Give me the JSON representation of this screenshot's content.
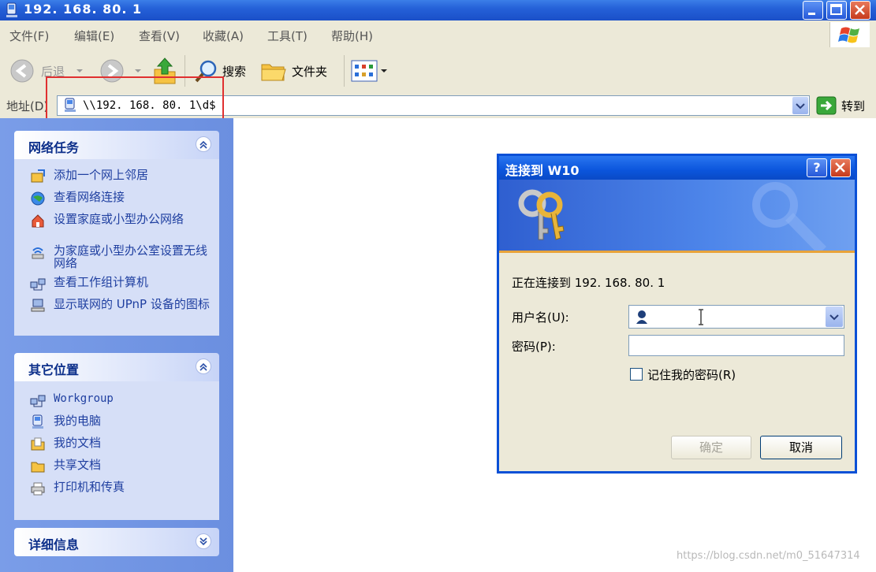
{
  "window": {
    "title": "192. 168. 80. 1"
  },
  "menu": {
    "items": [
      "文件(F)",
      "编辑(E)",
      "查看(V)",
      "收藏(A)",
      "工具(T)",
      "帮助(H)"
    ]
  },
  "toolbar": {
    "back_label": "后退",
    "search_label": "搜索",
    "folders_label": "文件夹"
  },
  "address": {
    "label": "地址(D)",
    "value": "\\\\192. 168. 80. 1\\d$",
    "go_label": "转到"
  },
  "left_pane": {
    "network_tasks": {
      "title": "网络任务",
      "items": [
        "添加一个网上邻居",
        "查看网络连接",
        "设置家庭或小型办公网络",
        "为家庭或小型办公室设置无线网络",
        "查看工作组计算机",
        "显示联网的 UPnP 设备的图标"
      ]
    },
    "other_places": {
      "title": "其它位置",
      "items": [
        "Workgroup",
        "我的电脑",
        "我的文档",
        "共享文档",
        "打印机和传真"
      ]
    },
    "details": {
      "title": "详细信息"
    }
  },
  "dialog": {
    "title": "连接到 W10",
    "help_label": "?",
    "connecting_text": "正在连接到 192. 168. 80. 1",
    "username_label": "用户名(U):",
    "username_value": "",
    "password_label": "密码(P):",
    "remember_label": "记住我的密码(R)",
    "ok_label": "确定",
    "cancel_label": "取消"
  },
  "watermark": "https://blog.csdn.net/m0_51647314",
  "colors": {
    "titlebar": "#2561d8",
    "left_pane": "#7a9de8",
    "highlight": "#e03030"
  }
}
